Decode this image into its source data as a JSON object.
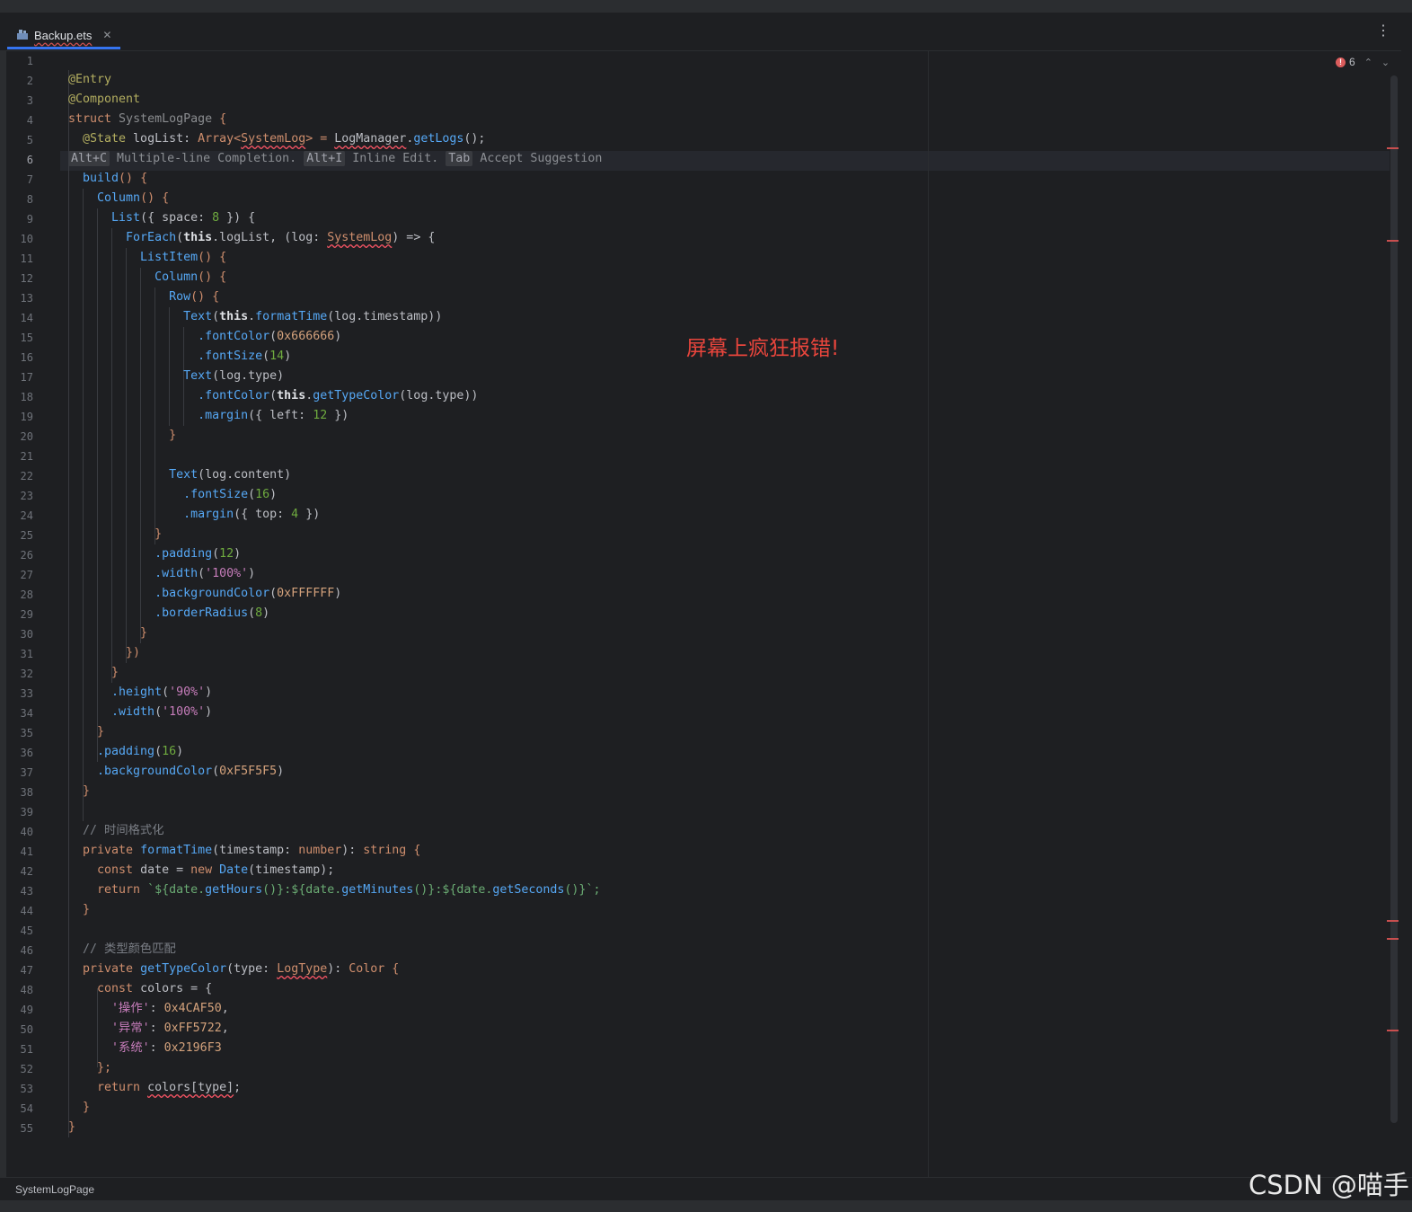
{
  "tab": {
    "label": "Backup.ets",
    "close_icon": "close-icon",
    "file_icon": "ets-file-icon"
  },
  "more_icon": "more-vertical-icon",
  "error_count": "6",
  "annotation": "屏幕上疯狂报错!",
  "status": {
    "breadcrumb": "SystemLogPage"
  },
  "watermark": "CSDN @喵手",
  "code": {
    "l2": "@Entry",
    "l3": "@Component",
    "l4a": "struct",
    "l4b": " SystemLogPage ",
    "l4c": "{",
    "l5a": "  @State",
    "l5b": " logList: ",
    "l5c": "Array<",
    "l5d": "SystemLog",
    "l5e": "> = ",
    "l5f": "LogManager",
    "l5g": ".",
    "l5h": "getLogs",
    "l5i": "();",
    "hint_k1": "Alt+C",
    "hint_t1": " Multiple-line Completion. ",
    "hint_k2": "Alt+I",
    "hint_t2": " Inline Edit. ",
    "hint_k3": "Tab",
    "hint_t3": " Accept Suggestion",
    "l7a": "  build",
    "l7b": "() {",
    "l8a": "    Column",
    "l8b": "() {",
    "l9a": "      List",
    "l9b": "({ space: ",
    "l9c": "8",
    "l9d": " }) {",
    "l10a": "        ForEach",
    "l10b": "(",
    "l10c": "this",
    "l10d": ".logList, (log: ",
    "l10e": "SystemLog",
    "l10f": ") => {",
    "l11a": "          ListItem",
    "l11b": "() {",
    "l12a": "            Column",
    "l12b": "() {",
    "l13a": "              Row",
    "l13b": "() {",
    "l14a": "                Text",
    "l14b": "(",
    "l14c": "this",
    "l14d": ".",
    "l14e": "formatTime",
    "l14f": "(log.timestamp))",
    "l15a": "                  .fontColor",
    "l15b": "(",
    "l15c": "0x666666",
    "l15d": ")",
    "l16a": "                  .fontSize",
    "l16b": "(",
    "l16c": "14",
    "l16d": ")",
    "l17a": "                Text",
    "l17b": "(log.type)",
    "l18a": "                  .fontColor",
    "l18b": "(",
    "l18c": "this",
    "l18d": ".",
    "l18e": "getTypeColor",
    "l18f": "(log.type))",
    "l19a": "                  .margin",
    "l19b": "({ left: ",
    "l19c": "12",
    "l19d": " })",
    "l20": "              }",
    "l22a": "              Text",
    "l22b": "(log.content)",
    "l23a": "                .fontSize",
    "l23b": "(",
    "l23c": "16",
    "l23d": ")",
    "l24a": "                .margin",
    "l24b": "({ top: ",
    "l24c": "4",
    "l24d": " })",
    "l25": "            }",
    "l26a": "            .padding",
    "l26b": "(",
    "l26c": "12",
    "l26d": ")",
    "l27a": "            .width",
    "l27b": "(",
    "l27c": "'100%'",
    "l27d": ")",
    "l28a": "            .backgroundColor",
    "l28b": "(",
    "l28c": "0xFFFFFF",
    "l28d": ")",
    "l29a": "            .borderRadius",
    "l29b": "(",
    "l29c": "8",
    "l29d": ")",
    "l30": "          }",
    "l31": "        })",
    "l32": "      }",
    "l33a": "      .height",
    "l33b": "(",
    "l33c": "'90%'",
    "l33d": ")",
    "l34a": "      .width",
    "l34b": "(",
    "l34c": "'100%'",
    "l34d": ")",
    "l35": "    }",
    "l36a": "    .padding",
    "l36b": "(",
    "l36c": "16",
    "l36d": ")",
    "l37a": "    .backgroundColor",
    "l37b": "(",
    "l37c": "0xF5F5F5",
    "l37d": ")",
    "l38": "  }",
    "l40": "  // 时间格式化",
    "l41a": "  private",
    "l41b": " formatTime",
    "l41c": "(timestamp: ",
    "l41d": "number",
    "l41e": "): ",
    "l41f": "string",
    "l41g": " {",
    "l42a": "    const",
    "l42b": " date = ",
    "l42c": "new",
    "l42d": " Date",
    "l42e": "(timestamp);",
    "l43a": "    return",
    "l43b": " `${date.",
    "l43c": "getHours",
    "l43d": "()}:${date.",
    "l43e": "getMinutes",
    "l43f": "()}:${date.",
    "l43g": "getSeconds",
    "l43h": "()}`;",
    "l44": "  }",
    "l46": "  // 类型颜色匹配",
    "l47a": "  private",
    "l47b": " getTypeColor",
    "l47c": "(type: ",
    "l47d": "LogType",
    "l47e": "): ",
    "l47f": "Color",
    "l47g": " {",
    "l48a": "    const",
    "l48b": " colors = {",
    "l49a": "      '操作'",
    "l49b": ": ",
    "l49c": "0x4CAF50",
    "l49d": ",",
    "l50a": "      '异常'",
    "l50b": ": ",
    "l50c": "0xFF5722",
    "l50d": ",",
    "l51a": "      '系统'",
    "l51b": ": ",
    "l51c": "0x2196F3",
    "l52": "    };",
    "l53a": "    return",
    "l53b": " ",
    "l53c": "colors[type]",
    "l53d": ";",
    "l54": "  }",
    "l55": "}"
  },
  "colors": {
    "accent": "#3574f0",
    "error": "#f75464",
    "annotation": "#e8453c"
  }
}
